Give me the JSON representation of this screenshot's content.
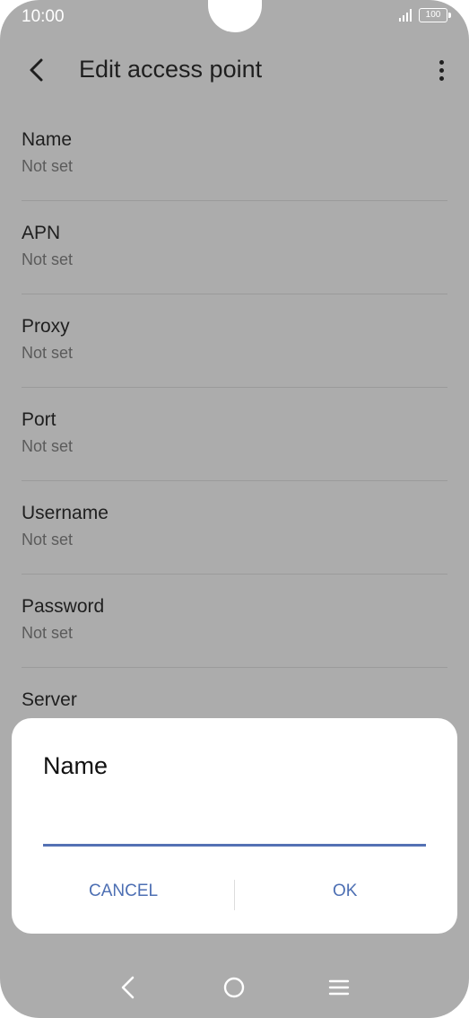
{
  "status_bar": {
    "time": "10:00",
    "battery": "100"
  },
  "app_bar": {
    "title": "Edit access point",
    "back_icon": "back-arrow-icon",
    "more_icon": "more-vertical-icon"
  },
  "preferences": [
    {
      "title": "Name",
      "summary": "Not set"
    },
    {
      "title": "APN",
      "summary": "Not set"
    },
    {
      "title": "Proxy",
      "summary": "Not set"
    },
    {
      "title": "Port",
      "summary": "Not set"
    },
    {
      "title": "Username",
      "summary": "Not set"
    },
    {
      "title": "Password",
      "summary": "Not set"
    },
    {
      "title": "Server",
      "summary": ""
    }
  ],
  "dialog": {
    "title": "Name",
    "input_value": "",
    "cancel_label": "CANCEL",
    "ok_label": "OK"
  },
  "nav_bar": {
    "back_icon": "nav-back-icon",
    "home_icon": "nav-home-icon",
    "menu_icon": "nav-menu-icon"
  },
  "colors": {
    "scrim": "#acacac",
    "accent": "#4d6fb3",
    "dialog_bg": "#ffffff"
  }
}
